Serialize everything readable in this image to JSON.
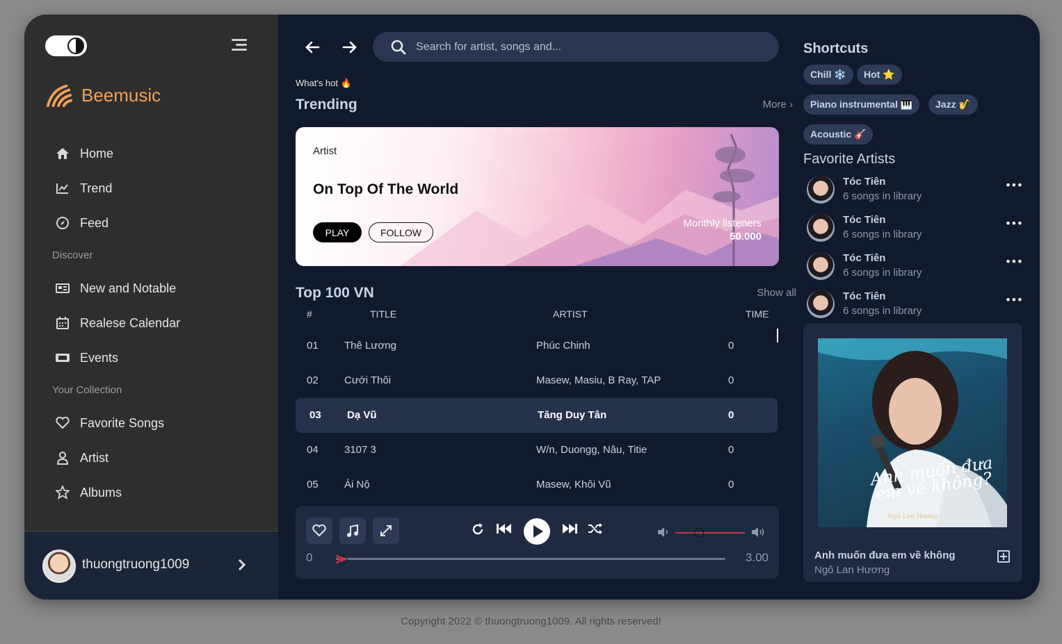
{
  "brand": {
    "name_a": "Bee",
    "name_b": "music"
  },
  "sidebar": {
    "items": [
      {
        "label": "Home",
        "icon": "home-icon"
      },
      {
        "label": "Trend",
        "icon": "trend-icon"
      },
      {
        "label": "Feed",
        "icon": "compass-icon"
      },
      {
        "label": "New and Notable",
        "icon": "news-icon"
      },
      {
        "label": "Realese Calendar",
        "icon": "calendar-icon"
      },
      {
        "label": "Events",
        "icon": "ticket-icon"
      },
      {
        "label": "Favorite Songs",
        "icon": "heart-icon"
      },
      {
        "label": "Artist",
        "icon": "user-icon"
      },
      {
        "label": "Albums",
        "icon": "star-icon"
      }
    ],
    "sections": {
      "discover": "Discover",
      "collection": "Your Collection"
    },
    "user": {
      "name": "thuongtruong1009"
    }
  },
  "search": {
    "placeholder": "Search for artist, songs and..."
  },
  "trending": {
    "kicker": "What's hot 🔥",
    "title": "Trending",
    "more": "More",
    "hero": {
      "label": "Artist",
      "title": "On Top Of The World",
      "play": "PLAY",
      "follow": "FOLLOW",
      "listeners_label": "Monthly listeners",
      "listeners_value": "50.000"
    }
  },
  "top100": {
    "title": "Top 100 VN",
    "show_all": "Show all",
    "headers": {
      "num": "#",
      "title": "TITLE",
      "artist": "ARTIST",
      "time": "TIME"
    },
    "rows": [
      {
        "num": "01",
        "title": "Thê Lương",
        "artist": "Phúc Chinh",
        "time": "0"
      },
      {
        "num": "02",
        "title": "Cưới Thôi",
        "artist": "Masew, Masiu, B Ray, TAP",
        "time": "0"
      },
      {
        "num": "03",
        "title": "Dạ Vũ",
        "artist": "Tăng Duy Tân",
        "time": "0"
      },
      {
        "num": "04",
        "title": "3107 3",
        "artist": "W/n, Duongg, Nâu, Titie",
        "time": "0"
      },
      {
        "num": "05",
        "title": "Ái Nộ",
        "artist": "Masew, Khôi Vũ",
        "time": "0"
      }
    ]
  },
  "player": {
    "current_time": "0",
    "duration": "3.00",
    "progress": 0.0,
    "volume": 0.35
  },
  "shortcuts": {
    "title": "Shortcuts",
    "chips": [
      "Chill ❄️",
      "Hot ⭐",
      "Piano instrumental 🎹",
      "Jazz 🎷",
      "Acoustic 🎸"
    ]
  },
  "favorite_artists": {
    "title": "Favorite Artists",
    "items": [
      {
        "name": "Tóc Tiên",
        "sub": "6 songs in library"
      },
      {
        "name": "Tóc Tiên",
        "sub": "6 songs in library"
      },
      {
        "name": "Tóc Tiên",
        "sub": "6 songs in library"
      },
      {
        "name": "Tóc Tiên",
        "sub": "6 songs in library"
      }
    ]
  },
  "now_playing": {
    "title": "Anh muốn đưa em về không",
    "artist": "Ngô Lan Hương",
    "cover_text": "Anh muốn đưa em về không?",
    "cover_artist": "Ngô Lan Hương"
  },
  "footer": {
    "copyright": "Copyright 2022 © thuongtruong1009. All rights reserved!"
  },
  "colors": {
    "accent": "#f0a05a",
    "bg": "#111a2c",
    "sidebar": "#2e2e2e",
    "card": "#1f2a40",
    "volume": "#c8334a"
  }
}
